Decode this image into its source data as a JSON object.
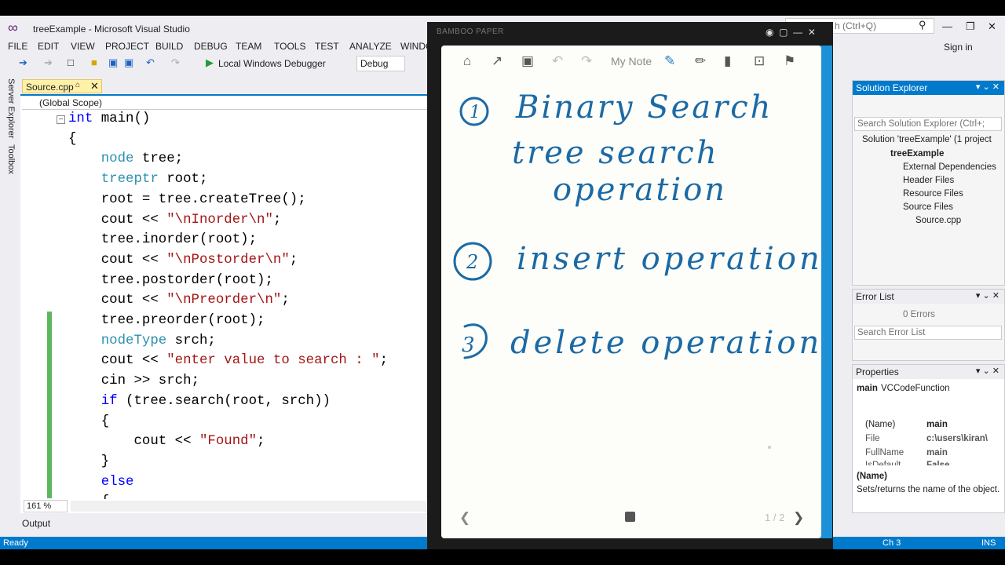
{
  "window": {
    "title": "treeExample - Microsoft Visual Studio",
    "quick_launch": "h (Ctrl+Q)",
    "sign_in": "Sign in"
  },
  "menu": [
    "FILE",
    "EDIT",
    "VIEW",
    "PROJECT",
    "BUILD",
    "DEBUG",
    "TEAM",
    "TOOLS",
    "TEST",
    "ANALYZE",
    "WINDO"
  ],
  "toolbar": {
    "debugger_label": "Local Windows Debugger",
    "config": "Debug"
  },
  "side_tabs": {
    "server_explorer": "Server Explorer",
    "toolbox": "Toolbox"
  },
  "editor": {
    "tab_label": "Source.cpp",
    "scope": "(Global Scope)",
    "zoom": "161 %",
    "lines": [
      [
        [
          "t",
          "int"
        ],
        [
          "n",
          " main()"
        ]
      ],
      [
        [
          "n",
          "{"
        ]
      ],
      [
        [
          "n",
          "    "
        ],
        [
          "y",
          "node"
        ],
        [
          "n",
          " tree;"
        ]
      ],
      [
        [
          "n",
          "    "
        ],
        [
          "y",
          "treeptr"
        ],
        [
          "n",
          " root;"
        ]
      ],
      [
        [
          "n",
          "    root = tree.createTree();"
        ]
      ],
      [
        [
          "n",
          "    cout << "
        ],
        [
          "s",
          "\"\\nInorder\\n\""
        ],
        [
          "n",
          ";"
        ]
      ],
      [
        [
          "n",
          "    tree.inorder(root);"
        ]
      ],
      [
        [
          "n",
          "    cout << "
        ],
        [
          "s",
          "\"\\nPostorder\\n\""
        ],
        [
          "n",
          ";"
        ]
      ],
      [
        [
          "n",
          "    tree.postorder(root);"
        ]
      ],
      [
        [
          "n",
          "    cout << "
        ],
        [
          "s",
          "\"\\nPreorder\\n\""
        ],
        [
          "n",
          ";"
        ]
      ],
      [
        [
          "n",
          "    tree.preorder(root);"
        ]
      ],
      [
        [
          "n",
          "    "
        ],
        [
          "y",
          "nodeType"
        ],
        [
          "n",
          " srch;"
        ]
      ],
      [
        [
          "n",
          "    cout << "
        ],
        [
          "s",
          "\"enter value to search : \""
        ],
        [
          "n",
          ";"
        ]
      ],
      [
        [
          "n",
          "    cin >> srch;"
        ]
      ],
      [
        [
          "n",
          "    "
        ],
        [
          "t",
          "if"
        ],
        [
          "n",
          " (tree.search(root, srch))"
        ]
      ],
      [
        [
          "n",
          "    {"
        ]
      ],
      [
        [
          "n",
          "        cout << "
        ],
        [
          "s",
          "\"Found\""
        ],
        [
          "n",
          ";"
        ]
      ],
      [
        [
          "n",
          "    }"
        ]
      ],
      [
        [
          "n",
          "    "
        ],
        [
          "t",
          "else"
        ]
      ],
      [
        [
          "n",
          "    {"
        ]
      ]
    ]
  },
  "output_tab": "Output",
  "status": {
    "left": "Ready",
    "ch": "Ch 3",
    "mode": "INS"
  },
  "solution_explorer": {
    "title": "Solution Explorer",
    "search_placeholder": "Search Solution Explorer (Ctrl+;",
    "items": [
      "Solution 'treeExample' (1 project",
      "treeExample",
      "External Dependencies",
      "Header Files",
      "Resource Files",
      "Source Files",
      "Source.cpp"
    ]
  },
  "error_list": {
    "title": "Error List",
    "errors": "0 Errors",
    "search_placeholder": "Search Error List"
  },
  "properties": {
    "title": "Properties",
    "object": "main",
    "object_type": "VCCodeFunction",
    "rows": [
      {
        "name": "(Name)",
        "value": "main"
      },
      {
        "name": "File",
        "value": "c:\\users\\kiran\\"
      },
      {
        "name": "FullName",
        "value": "main"
      },
      {
        "name": "IsDefault",
        "value": "False"
      }
    ],
    "desc_title": "(Name)",
    "desc_text": "Sets/returns the name of the object."
  },
  "bamboo": {
    "app_title": "BAMBOO PAPER",
    "note_title": "My Note",
    "page": "1 / 2",
    "handwriting": {
      "item1_num": "1",
      "item1_line1": "Binary Search",
      "item1_line2": "tree search",
      "item1_line3": "operation",
      "item2_num": "2",
      "item2": "insert operation",
      "item3_num": "3",
      "item3": "delete operation"
    }
  }
}
